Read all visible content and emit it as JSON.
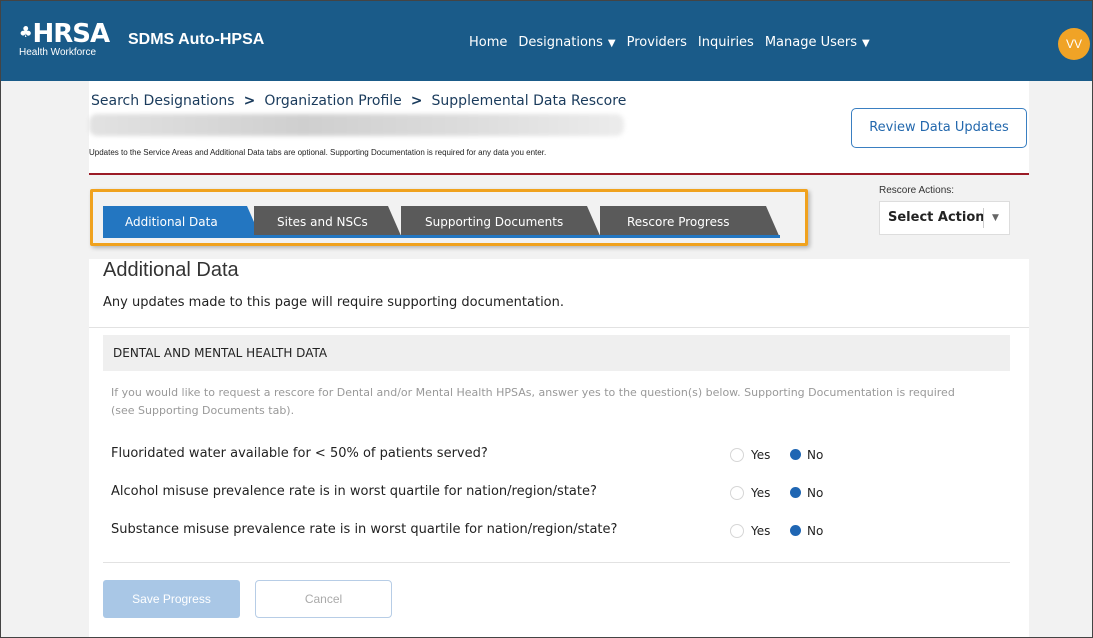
{
  "header": {
    "logo_main": "HRSA",
    "logo_sub": "Health Workforce",
    "app_title": "SDMS Auto-HPSA",
    "nav": [
      {
        "label": "Home",
        "dropdown": false
      },
      {
        "label": "Designations",
        "dropdown": true
      },
      {
        "label": "Providers",
        "dropdown": false
      },
      {
        "label": "Inquiries",
        "dropdown": false
      },
      {
        "label": "Manage Users",
        "dropdown": true
      }
    ],
    "avatar_initials": "VV",
    "bar_color": "#1a5b89",
    "avatar_color": "#f0a326"
  },
  "breadcrumb": [
    "Search Designations",
    "Organization Profile",
    "Supplemental Data Rescore"
  ],
  "breadcrumb_separator": ">",
  "review_button": "Review Data Updates",
  "optional_note": "Updates to the Service Areas and Additional Data tabs are optional. Supporting Documentation is required for any data you enter.",
  "tabs": [
    {
      "label": "Additional Data",
      "active": true
    },
    {
      "label": "Sites and NSCs",
      "active": false
    },
    {
      "label": "Supporting Documents",
      "active": false
    },
    {
      "label": "Rescore Progress",
      "active": false
    }
  ],
  "rescore_actions": {
    "label": "Rescore Actions:",
    "selected": "Select Action"
  },
  "section": {
    "title": "Additional Data",
    "subtitle": "Any updates made to this page will require supporting documentation."
  },
  "dental_mental": {
    "heading": "DENTAL AND MENTAL HEALTH DATA",
    "instructions": "If you would like to request a rescore for Dental and/or Mental Health HPSAs, answer yes to the question(s) below. Supporting Documentation is required (see Supporting Documents tab).",
    "yes_label": "Yes",
    "no_label": "No",
    "questions": [
      {
        "text": "Fluoridated water available for < 50% of patients served?",
        "answer": "No"
      },
      {
        "text": "Alcohol misuse prevalence rate is in worst quartile for nation/region/state?",
        "answer": "No"
      },
      {
        "text": "Substance misuse prevalence rate is in worst quartile for nation/region/state?",
        "answer": "No"
      }
    ]
  },
  "buttons": {
    "save": "Save Progress",
    "cancel": "Cancel"
  },
  "colors": {
    "accent": "#2376c1",
    "highlight": "#f0a21e",
    "divider_red": "#9b1b26"
  },
  "icons": [
    "eagle-icon",
    "chevron-down-icon",
    "radio-icon"
  ]
}
